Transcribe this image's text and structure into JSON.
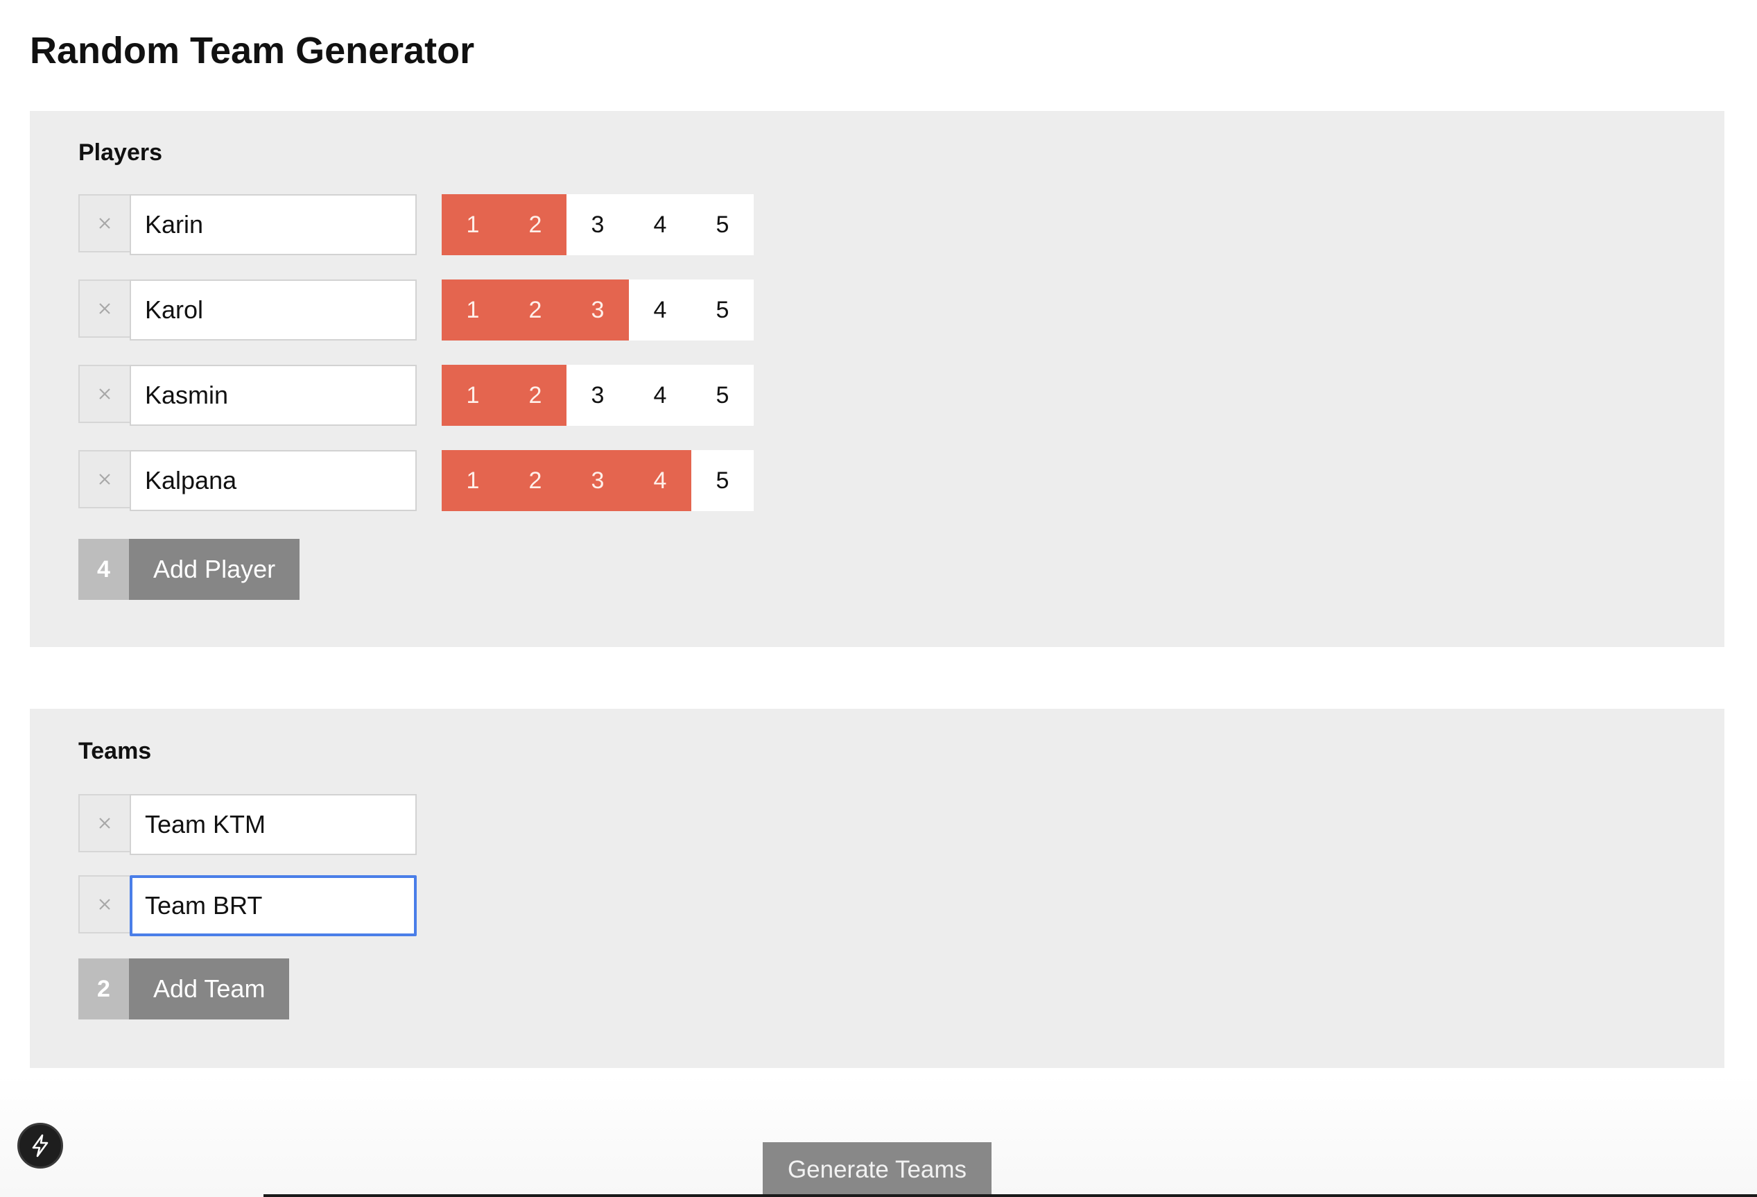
{
  "app": {
    "title": "Random Team Generator"
  },
  "players": {
    "heading": "Players",
    "rating_scale": [
      "1",
      "2",
      "3",
      "4",
      "5"
    ],
    "items": [
      {
        "name": "Karin",
        "rating": 2
      },
      {
        "name": "Karol",
        "rating": 3
      },
      {
        "name": "Kasmin",
        "rating": 2
      },
      {
        "name": "Kalpana",
        "rating": 4
      }
    ],
    "count": "4",
    "add_label": "Add Player"
  },
  "teams": {
    "heading": "Teams",
    "items": [
      {
        "name": "Team KTM",
        "focused": false
      },
      {
        "name": "Team BRT",
        "focused": true
      }
    ],
    "count": "2",
    "add_label": "Add Team"
  },
  "generate_label": "Generate Teams",
  "colors": {
    "rating_active": "#e4654f",
    "panel": "#ededed",
    "button": "#868686",
    "focus": "#4a7ee8"
  },
  "icons": {
    "remove": "close-icon",
    "floating": "lightning-bolt-icon"
  }
}
